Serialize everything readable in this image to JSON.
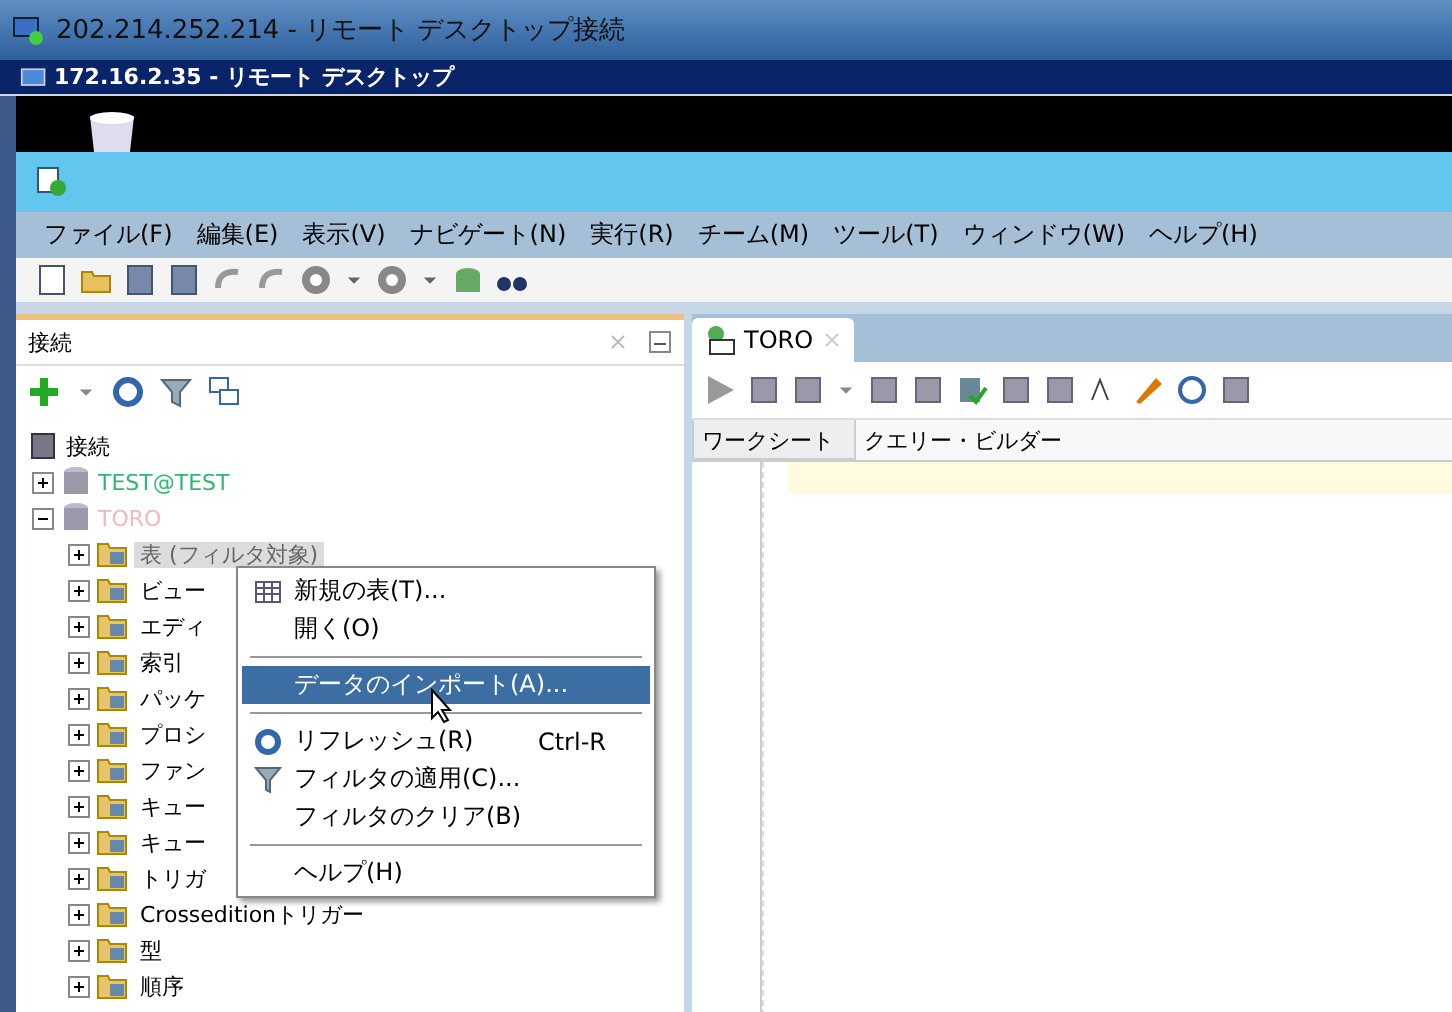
{
  "window": {
    "title": "202.214.252.214 - リモート デスクトップ接続"
  },
  "remote_bar": {
    "title": "172.16.2.35 - リモート デスクトップ"
  },
  "menu_bar": [
    "ファイル(F)",
    "編集(E)",
    "表示(V)",
    "ナビゲート(N)",
    "実行(R)",
    "チーム(M)",
    "ツール(T)",
    "ウィンドウ(W)",
    "ヘルプ(H)"
  ],
  "connections_panel": {
    "title": "接続",
    "tree": {
      "label": "接続",
      "children": [
        {
          "label": "TEST@TEST",
          "color": "#2eb872",
          "expanded": false
        },
        {
          "label": "TORO",
          "color": "#f4b8b8",
          "expanded": true,
          "children": [
            {
              "label": "表 (フィルタ対象)",
              "selected": true
            },
            {
              "label": "ビュー",
              "selected": false
            },
            {
              "label": "エディ",
              "selected": false
            },
            {
              "label": "索引",
              "selected": false
            },
            {
              "label": "パッケ",
              "selected": false
            },
            {
              "label": "プロシ",
              "selected": false
            },
            {
              "label": "ファン",
              "selected": false
            },
            {
              "label": "キュー",
              "selected": false
            },
            {
              "label": "キュー",
              "selected": false
            },
            {
              "label": "トリガ",
              "selected": false
            },
            {
              "label": "Crosseditionトリガー",
              "selected": false
            },
            {
              "label": "型",
              "selected": false
            },
            {
              "label": "順序",
              "selected": false
            }
          ]
        }
      ]
    }
  },
  "context_menu": [
    {
      "kind": "item",
      "label": "新規の表(T)...",
      "selected": false
    },
    {
      "kind": "item",
      "label": "開く(O)",
      "selected": false
    },
    {
      "kind": "separator"
    },
    {
      "kind": "item",
      "label": "データのインポート(A)...",
      "selected": true
    },
    {
      "kind": "separator"
    },
    {
      "kind": "item",
      "label": "リフレッシュ(R)",
      "shortcut": "Ctrl-R",
      "selected": false
    },
    {
      "kind": "item",
      "label": "フィルタの適用(C)...",
      "selected": false
    },
    {
      "kind": "item",
      "label": "フィルタのクリア(B)",
      "selected": false
    },
    {
      "kind": "separator"
    },
    {
      "kind": "item",
      "label": "ヘルプ(H)",
      "selected": false
    }
  ],
  "editor": {
    "tab": "TORO",
    "subtabs": [
      {
        "label": "ワークシート",
        "selected": true
      },
      {
        "label": "クエリー・ビルダー",
        "selected": false
      }
    ]
  }
}
